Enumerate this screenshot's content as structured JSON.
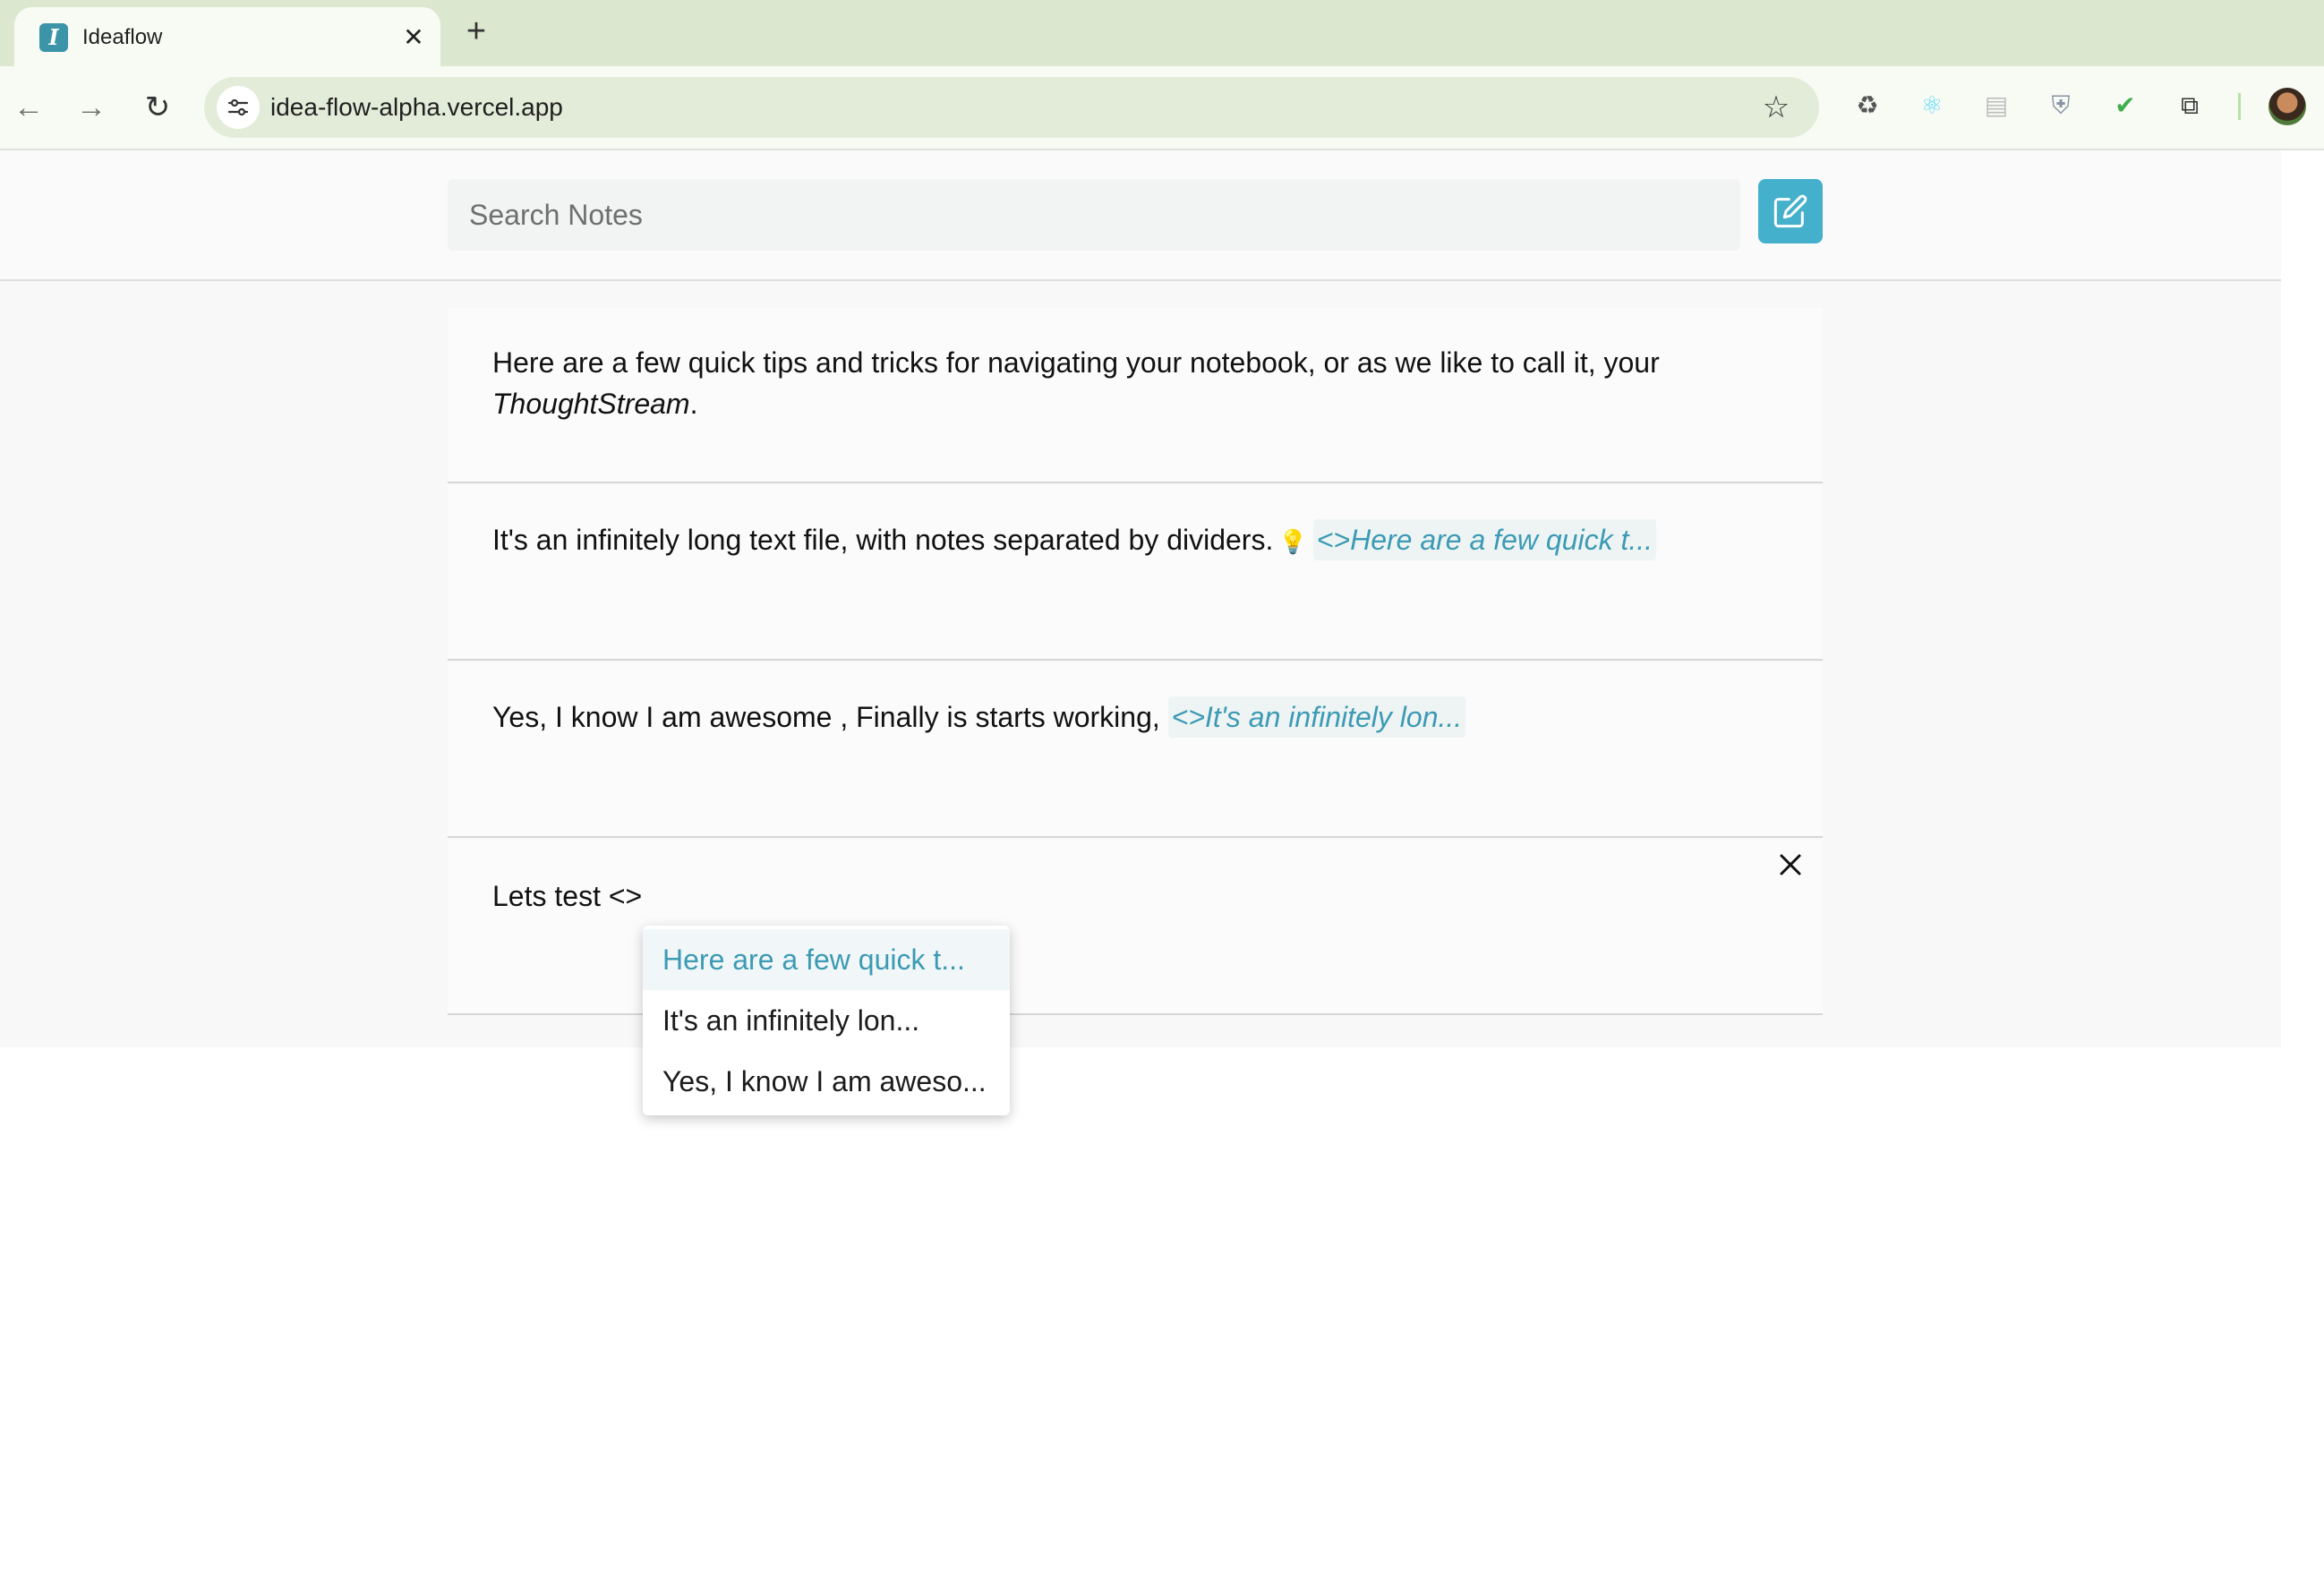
{
  "browser": {
    "tab_title": "Ideaflow",
    "tab_favicon_letter": "I",
    "tab_close_glyph": "✕",
    "new_tab_glyph": "+",
    "back_glyph": "←",
    "forward_glyph": "→",
    "reload_glyph": "↻",
    "url": "idea-flow-alpha.vercel.app",
    "bookmark_glyph": "☆",
    "extensions": [
      {
        "name": "recycle-extension-icon",
        "glyph": "♻",
        "color": "#555555"
      },
      {
        "name": "react-devtools-icon",
        "glyph": "⚛",
        "color": "#61dafb"
      },
      {
        "name": "printer-extension-icon",
        "glyph": "▤",
        "color": "#bdbdbd"
      },
      {
        "name": "shield-extension-icon",
        "glyph": "⛨",
        "color": "#8a93a6"
      },
      {
        "name": "checkmark-shield-icon",
        "glyph": "✔",
        "color": "#3fae4d"
      },
      {
        "name": "puzzle-extensions-icon",
        "glyph": "⧉",
        "color": "#333333"
      }
    ]
  },
  "search": {
    "placeholder": "Search Notes",
    "value": ""
  },
  "notes": [
    {
      "text": "Here are a few quick tips and tricks for navigating your notebook, or as we like to call it, your",
      "emphasis": "ThoughtStream",
      "trailing": "."
    },
    {
      "text": "It's an infinitely long text file, with notes separated by dividers.",
      "bulb": "💡",
      "link": "<>Here are a few quick t..."
    },
    {
      "text": "Yes, I know I am awesome , Finally is starts working,",
      "link": "<>It's an infinitely lon..."
    },
    {
      "text": "Lets test <>"
    }
  ],
  "mention_dropdown": {
    "items": [
      "Here are a few quick t...",
      "It's an infinitely lon...",
      "Yes, I know I am aweso..."
    ],
    "active_index": 0
  },
  "colors": {
    "accent": "#45b0cc",
    "link": "#3c9ab4",
    "chrome_bg": "#dbe8cf"
  }
}
